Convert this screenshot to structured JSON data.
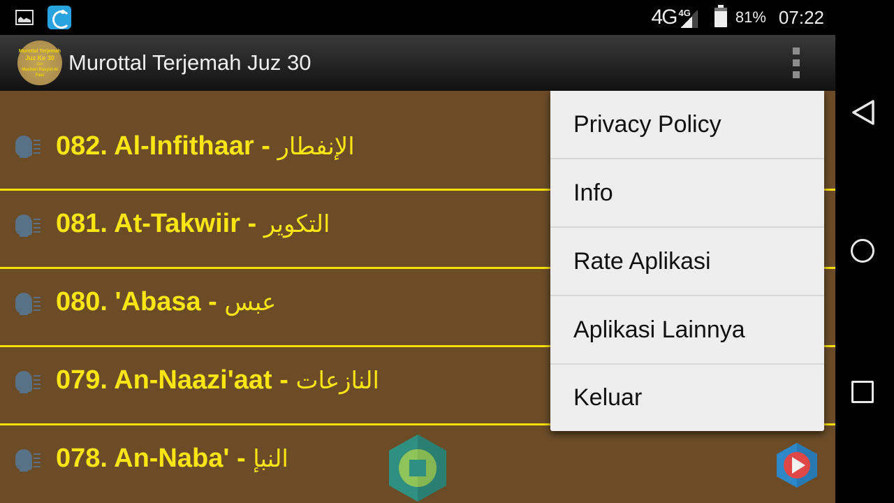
{
  "status_bar": {
    "notifications": [
      "image-notification-icon",
      "app-notification-icon"
    ],
    "network": "4G",
    "network_small": "4G",
    "battery_percent": "81%",
    "battery_level": 0.81,
    "time": "07:22"
  },
  "action_bar": {
    "logo": {
      "line1": "Murottal Terjemah",
      "line2": "Juz Ke 30",
      "line3": "Qari",
      "line4": "Mashari Rasyid Al Fasi"
    },
    "title": "Murottal Terjemah Juz 30",
    "overflow_icon": "more-vert-icon"
  },
  "surah_list": {
    "items": [
      {
        "number": "082.",
        "latin": "Al-Infithaar",
        "separator": " - ",
        "arabic": "الإنفطار",
        "icon": "speaking-head-icon"
      },
      {
        "number": "081.",
        "latin": "At-Takwiir",
        "separator": " - ",
        "arabic": "التكوير",
        "icon": "speaking-head-icon"
      },
      {
        "number": "080.",
        "latin": "'Abasa",
        "separator": " - ",
        "arabic": "عبس",
        "icon": "speaking-head-icon"
      },
      {
        "number": "079.",
        "latin": "An-Naazi'aat",
        "separator": " - ",
        "arabic": "النازعات",
        "icon": "speaking-head-icon"
      },
      {
        "number": "078.",
        "latin": "An-Naba'",
        "separator": " - ",
        "arabic": "النبإ",
        "icon": "speaking-head-icon"
      }
    ]
  },
  "fabs": {
    "stop": "stop-icon",
    "play": "play-icon"
  },
  "overflow_menu": {
    "items": [
      "Privacy Policy",
      "Info",
      "Rate Aplikasi",
      "Aplikasi Lainnya",
      "Keluar"
    ]
  },
  "nav_bar": {
    "back": "back-icon",
    "home": "home-icon",
    "recents": "recents-icon"
  },
  "colors": {
    "list_background": "#6b4c27",
    "title_yellow": "#f9e512",
    "divider_yellow": "#f5e00e",
    "menu_background": "#eeeeee"
  }
}
